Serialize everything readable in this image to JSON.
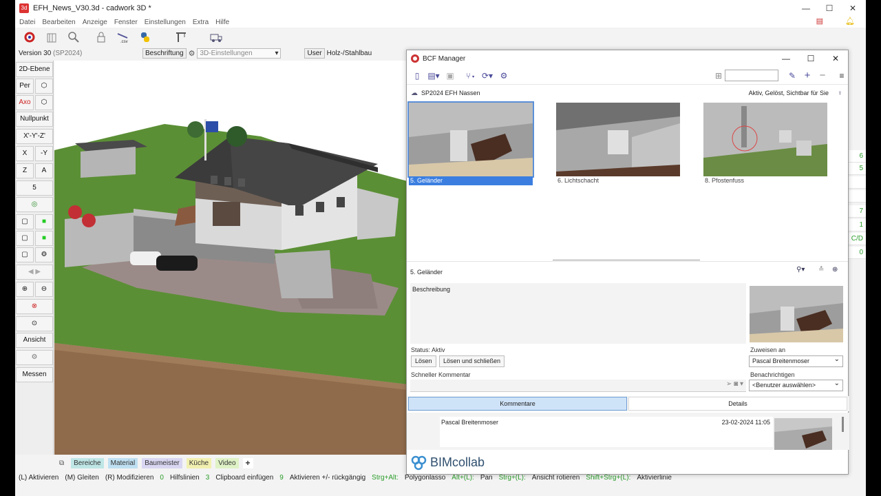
{
  "window": {
    "title": "EFH_News_V30.3d - cadwork 3D *"
  },
  "menu": [
    "Datei",
    "Bearbeiten",
    "Anzeige",
    "Fenster",
    "Einstellungen",
    "Extra",
    "Hilfe"
  ],
  "toolbar_icons": [
    "cadwork-logo-icon",
    "building-icon",
    "search-icon",
    "lock-icon",
    "csv-export-icon",
    "python-icon",
    "crane-icon",
    "truck-icon"
  ],
  "statusrow": {
    "version": "Version 30",
    "sp": "(SP2024)",
    "beschriftung": "Beschriftung",
    "settings_placeholder": "3D-Einstellungen",
    "user": "User",
    "user_value": "Holz-/Stahlbau"
  },
  "palette": {
    "ebene": "2D-Ebene",
    "per": "Per",
    "axo": "Axo",
    "nullpunkt": "Nullpunkt",
    "xyz": "X'-Y'-Z'",
    "x": "X",
    "minus_y": "-Y",
    "z": "Z",
    "a": "A",
    "five": "5",
    "ansicht": "Ansicht",
    "messen": "Messen"
  },
  "bottom_tabs": [
    "Bereiche",
    "Material",
    "Baumeister",
    "Küche",
    "Video",
    "+"
  ],
  "tab_colors": [
    "#bfe6e6",
    "#bfe0f2",
    "#d9d6f2",
    "#f2f0b0",
    "#dff2c6",
    "#ffffff"
  ],
  "hints": [
    {
      "text": "(L) Aktivieren",
      "color": "#222"
    },
    {
      "text": "(M) Gleiten",
      "color": "#222"
    },
    {
      "text": "(R) Modifizieren",
      "color": "#222"
    },
    {
      "text": "0",
      "color": "#2a9c2a"
    },
    {
      "text": "Hilfslinien",
      "color": "#222"
    },
    {
      "text": "3",
      "color": "#2a9c2a"
    },
    {
      "text": "Clipboard einfügen",
      "color": "#222"
    },
    {
      "text": "9",
      "color": "#2a9c2a"
    },
    {
      "text": "Aktivieren +/- rückgängig",
      "color": "#222"
    },
    {
      "text": "Strg+Alt:",
      "color": "#2a9c2a"
    },
    {
      "text": "Polygonlasso",
      "color": "#222"
    },
    {
      "text": "Alt+(L):",
      "color": "#2a9c2a"
    },
    {
      "text": "Pan",
      "color": "#222"
    },
    {
      "text": "Strg+(L):",
      "color": "#2a9c2a"
    },
    {
      "text": "Ansicht rotieren",
      "color": "#222"
    },
    {
      "text": "Shift+Strg+(L):",
      "color": "#2a9c2a"
    },
    {
      "text": "Aktivierlinie",
      "color": "#222"
    }
  ],
  "right_strip": [
    "6",
    "5",
    "",
    "",
    "7",
    "1",
    "C/D",
    "0"
  ],
  "bcf": {
    "title": "BCF Manager",
    "project": "SP2024 EFH Nassen",
    "filter": "Aktiv, Gelöst, Sichtbar für Sie",
    "issues": [
      "5. Geländer",
      "6. Lichtschacht",
      "8. Pfostenfuss"
    ],
    "selected_issue": "5. Geländer",
    "beschreibung_label": "Beschreibung",
    "status_label": "Status: Aktiv",
    "loesen": "Lösen",
    "loesen_schliessen": "Lösen und schließen",
    "zuweisen_label": "Zuweisen an",
    "zuweisen_value": "Pascal Breitenmoser",
    "benachrichtigen_label": "Benachrichtigen",
    "benachrichtigen_value": "<Benutzer auswählen>",
    "schneller_kommentar": "Schneller Kommentar",
    "tab_kommentare": "Kommentare",
    "tab_details": "Details",
    "comment_author": "Pascal Breitenmoser",
    "comment_date": "23-02-2024 11:05",
    "brand": "BIMcollab"
  }
}
